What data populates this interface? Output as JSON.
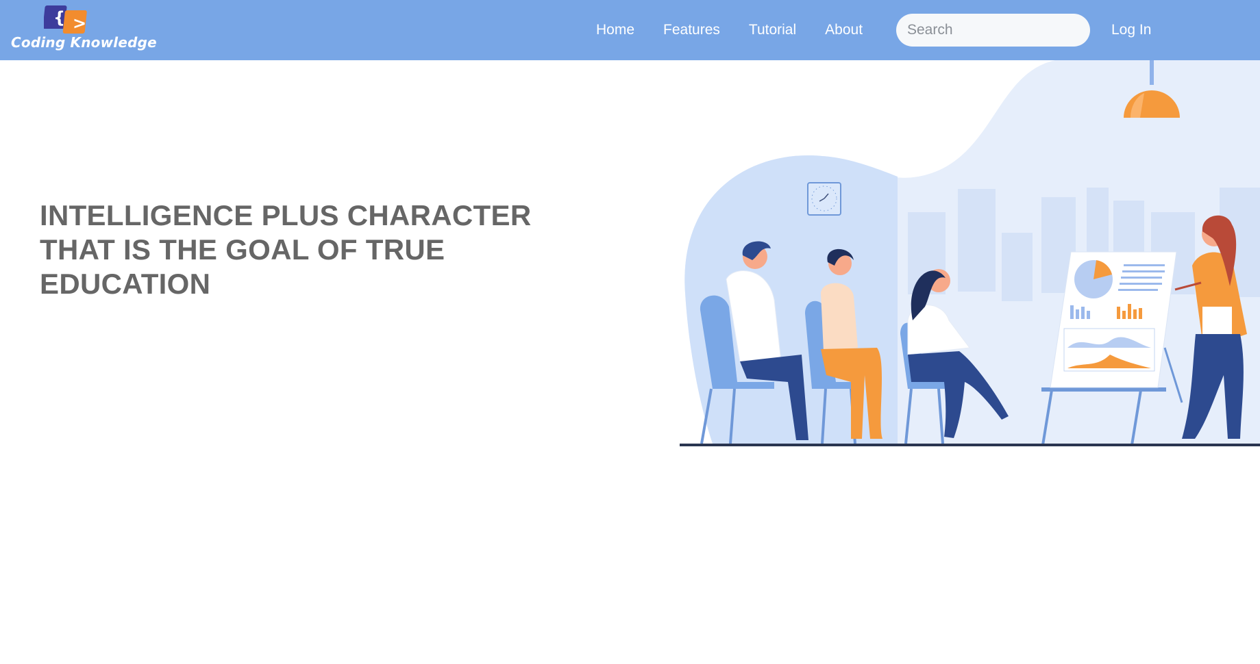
{
  "brand": {
    "name": "Coding Knowledge",
    "logo_glyph_left": "{",
    "logo_glyph_right": ">",
    "logo_colors": {
      "left": "#3d3c9c",
      "right": "#f28c2e"
    }
  },
  "nav": {
    "links": [
      {
        "label": "Home"
      },
      {
        "label": "Features"
      },
      {
        "label": "Tutorial"
      },
      {
        "label": "About"
      }
    ],
    "search_placeholder": "Search",
    "login_label": "Log In"
  },
  "hero": {
    "lines": [
      "INTELLIGENCE PLUS CHARACTER",
      "THAT IS THE GOAL OF TRUE",
      "EDUCATION"
    ]
  },
  "colors": {
    "navbar": "#78a6e6",
    "hero_text": "#666666",
    "accent_orange": "#f59a3d",
    "accent_blue": "#2d4a8f",
    "light_blue": "#cfe0f9"
  },
  "illustration": {
    "icons": [
      "pendant-lamp-icon",
      "wall-clock-icon",
      "presentation-board-icon"
    ]
  }
}
